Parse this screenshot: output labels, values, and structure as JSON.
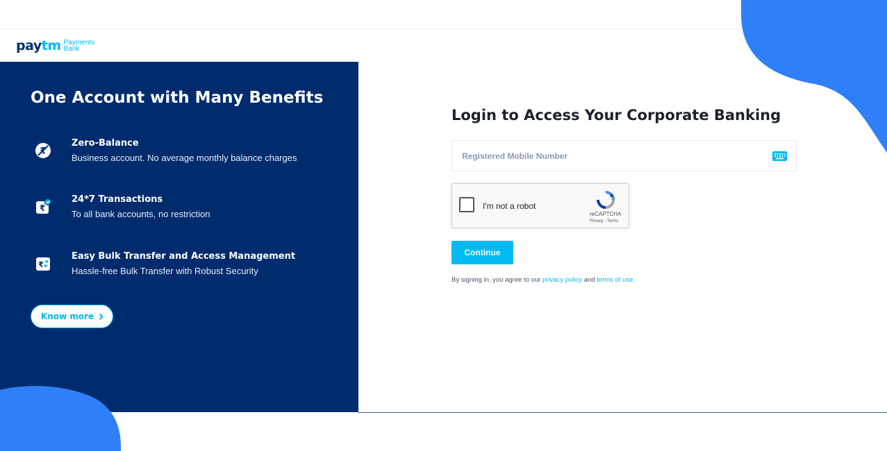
{
  "brand": {
    "logo_main_a": "pay",
    "logo_main_b": "tm",
    "logo_sub_line1": "Payments",
    "logo_sub_line2": "Bank"
  },
  "left_panel": {
    "title": "One Account with Many Benefits",
    "benefits": [
      {
        "icon": "zero-balance-icon",
        "title": "Zero-Balance",
        "description": "Business account. No average monthly balance charges"
      },
      {
        "icon": "rupee-transaction-icon",
        "title": "24*7 Transactions",
        "description": "To all bank accounts, no restriction"
      },
      {
        "icon": "bulk-transfer-icon",
        "title": "Easy Bulk Transfer and Access Management",
        "description": "Hassle-free Bulk Transfer with Robust Security"
      }
    ],
    "know_more_label": "Know more"
  },
  "login": {
    "title": "Login to Access Your Corporate Banking",
    "mobile_placeholder": "Registered Mobile Number",
    "mobile_value": "",
    "recaptcha": {
      "label": "I'm not a robot",
      "brand": "reCAPTCHA",
      "privacy": "Privacy",
      "separator": " - ",
      "terms": "Terms",
      "checked": false
    },
    "continue_label": "Continue",
    "agreement": {
      "prefix": "By signing in, you agree to our ",
      "privacy_link": "privacy policy",
      "middle": " and ",
      "terms_link": "terms of use."
    }
  },
  "colors": {
    "navy": "#002c6e",
    "brand_cyan": "#00b9f1",
    "blob_blue": "#2f80f8",
    "continue_bg": "#00baf2"
  }
}
